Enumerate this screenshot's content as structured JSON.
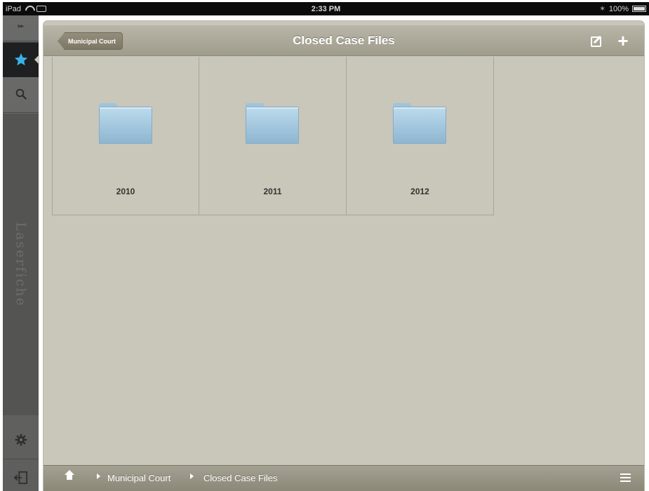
{
  "statusbar": {
    "device": "iPad",
    "time": "2:33 PM",
    "battery": "100%"
  },
  "sidebar": {
    "expand_label": "▸▸",
    "brand": "Laserfiche"
  },
  "navbar": {
    "back_label": "Municipal Court",
    "title": "Closed Case Files"
  },
  "folders": [
    {
      "label": "2010"
    },
    {
      "label": "2011"
    },
    {
      "label": "2012"
    }
  ],
  "footer": {
    "breadcrumb": [
      "Municipal Court",
      "Closed Case Files"
    ]
  },
  "colors": {
    "panel_bg": "#c9c6ba",
    "navbar": "#a8a596",
    "active_star": "#3ab0e8",
    "folder": "#a8cde3"
  },
  "icons": [
    "wifi-icon",
    "battery-icon",
    "star-icon",
    "search-icon",
    "gear-icon",
    "logout-icon",
    "edit-icon",
    "add-icon",
    "folder-icon",
    "home-icon",
    "list-icon"
  ]
}
